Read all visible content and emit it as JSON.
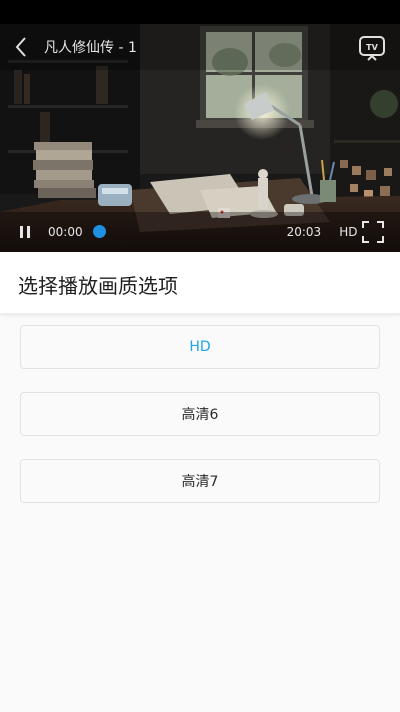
{
  "player": {
    "title": "凡人修仙传 - 1",
    "current_time": "00:00",
    "total_time": "20:03",
    "quality": "HD",
    "progress_fraction": 0.0,
    "icons": {
      "back": "back-arrow-icon",
      "tv": "tv-cast-icon",
      "pause": "pause-icon",
      "fullscreen": "fullscreen-icon"
    }
  },
  "panel": {
    "title": "选择播放画质选项"
  },
  "options": [
    {
      "label": "HD",
      "selected": true
    },
    {
      "label": "高清6",
      "selected": false
    },
    {
      "label": "高清7",
      "selected": false
    }
  ],
  "colors": {
    "accent": "#1ca6e6",
    "seek_thumb": "#1e8fe1",
    "panel_background": "#fafafa"
  }
}
